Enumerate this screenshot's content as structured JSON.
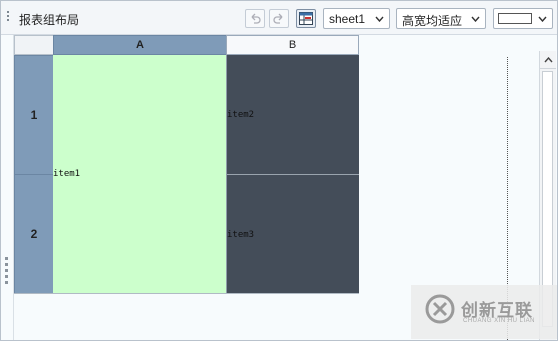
{
  "toolbar": {
    "title": "报表组布局",
    "sheet_select": "sheet1",
    "fit_select": "高宽均适应"
  },
  "grid": {
    "columns": [
      "A",
      "B"
    ],
    "rows": [
      "1",
      "2"
    ],
    "cells": {
      "item1": "item1",
      "item2": "item2",
      "item3": "item3"
    }
  },
  "colors": {
    "item1_bg": "#ccffcc",
    "item2_bg": "#444d59",
    "selected_header": "#7f9bb8"
  },
  "watermark": {
    "brand": "创新互联",
    "sub": "CHUANG XIN HU LIAN"
  }
}
